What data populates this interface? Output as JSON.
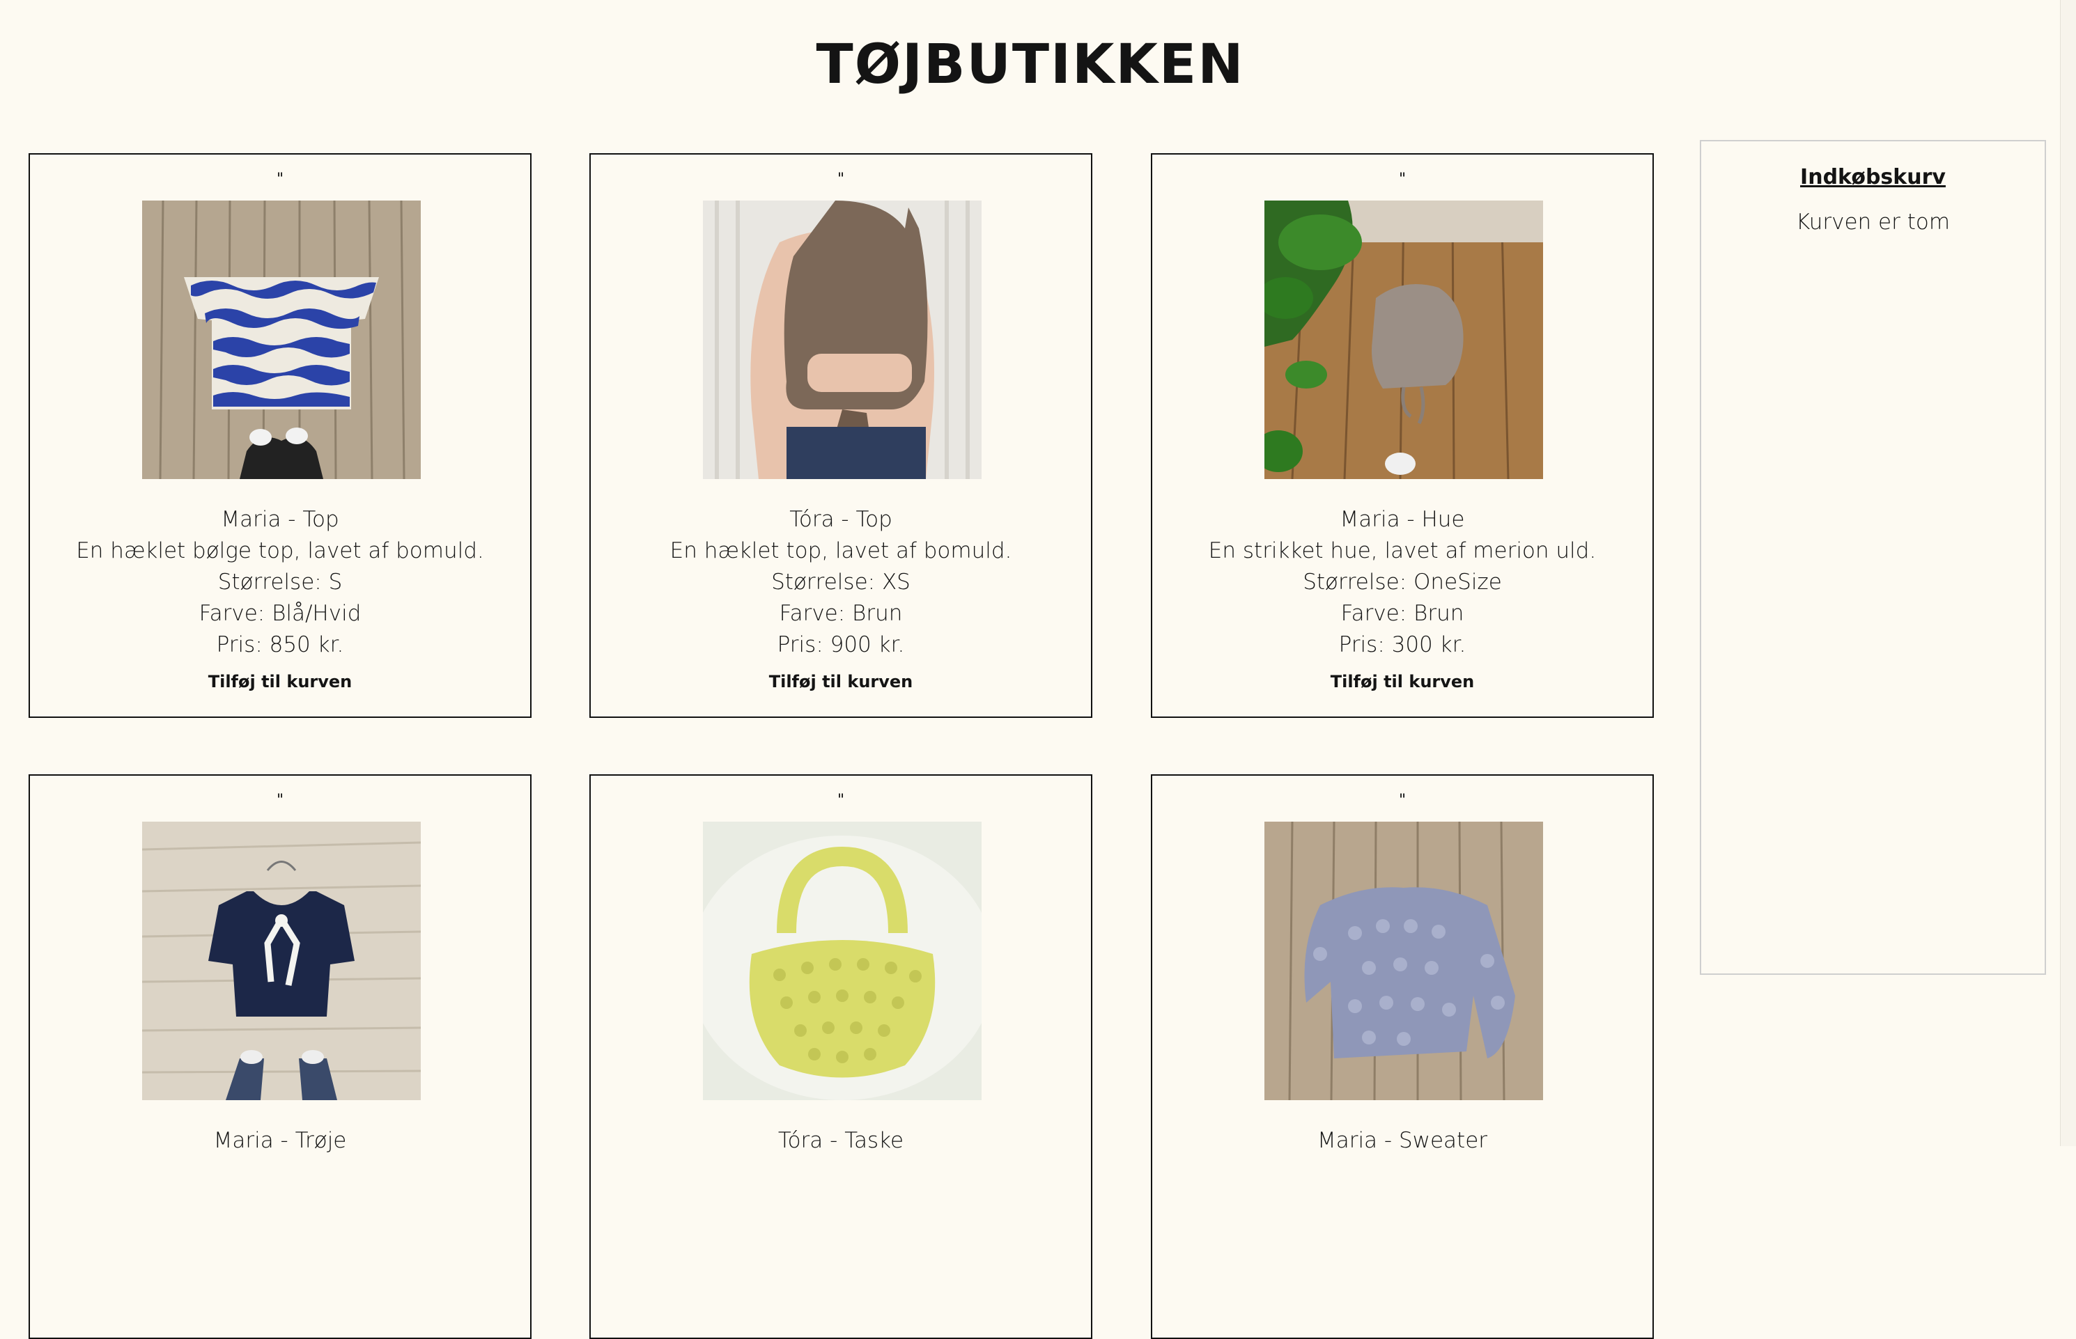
{
  "header": {
    "title": "TØJBUTIKKEN"
  },
  "products": [
    {
      "quote": "\"",
      "image_icon": "blue-white-wave-crochet-top-photo",
      "name": "Maria - Top",
      "description": "En hæklet bølge top, lavet af bomuld.",
      "size": "Størrelse: S",
      "color": "Farve: Blå/Hvid",
      "price": "Pris: 850 kr.",
      "button": "Tilføj til kurven"
    },
    {
      "quote": "\"",
      "image_icon": "brown-crochet-backless-top-photo",
      "name": "Tóra - Top",
      "description": "En hæklet top, lavet af bomuld.",
      "size": "Størrelse: XS",
      "color": "Farve: Brun",
      "price": "Pris: 900 kr.",
      "button": "Tilføj til kurven"
    },
    {
      "quote": "\"",
      "image_icon": "brown-knit-hood-photo",
      "name": "Maria - Hue",
      "description": "En strikket hue, lavet af merion uld.",
      "size": "Størrelse: OneSize",
      "color": "Farve: Brun",
      "price": "Pris: 300 kr.",
      "button": "Tilføj til kurven"
    },
    {
      "quote": "\"",
      "image_icon": "navy-crochet-cardigan-photo",
      "name": "Maria - Trøje"
    },
    {
      "quote": "\"",
      "image_icon": "yellow-bobble-bag-photo",
      "name": "Tóra - Taske"
    },
    {
      "quote": "\"",
      "image_icon": "grey-mohair-sweater-photo",
      "name": "Maria - Sweater"
    }
  ],
  "cart": {
    "title": "Indkøbskurv",
    "empty_text": "Kurven er tom"
  }
}
